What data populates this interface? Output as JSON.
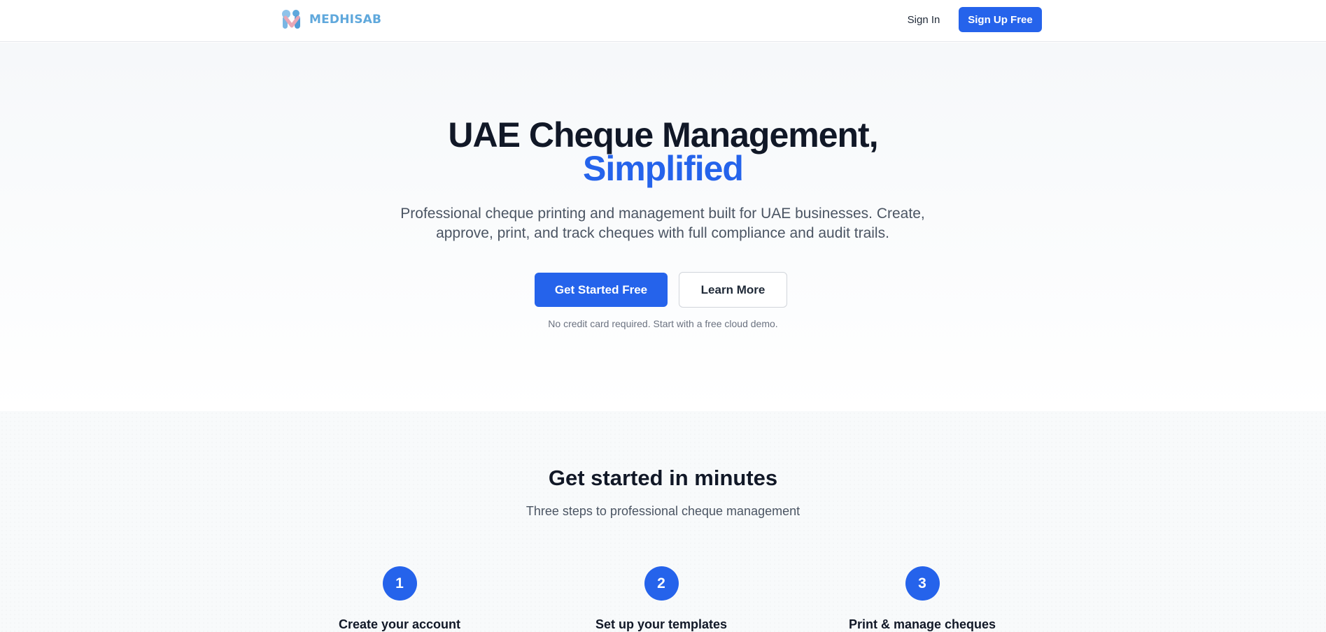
{
  "header": {
    "brand": "MEDHISAB",
    "signin_label": "Sign In",
    "signup_label": "Sign Up Free"
  },
  "hero": {
    "title_line1": "UAE Cheque Management,",
    "title_line2": "Simplified",
    "subtitle": "Professional cheque printing and management built for UAE businesses. Create, approve, print, and track cheques with full compliance and audit trails.",
    "primary_cta": "Get Started Free",
    "secondary_cta": "Learn More",
    "note": "No credit card required. Start with a free cloud demo."
  },
  "steps": {
    "title": "Get started in minutes",
    "subtitle": "Three steps to professional cheque management",
    "items": [
      {
        "number": "1",
        "title": "Create your account"
      },
      {
        "number": "2",
        "title": "Set up your templates"
      },
      {
        "number": "3",
        "title": "Print & manage cheques"
      }
    ]
  },
  "colors": {
    "accent": "#2563eb",
    "brand": "#5fa8dc",
    "text_dark": "#111827",
    "text_muted": "#4b5563"
  }
}
